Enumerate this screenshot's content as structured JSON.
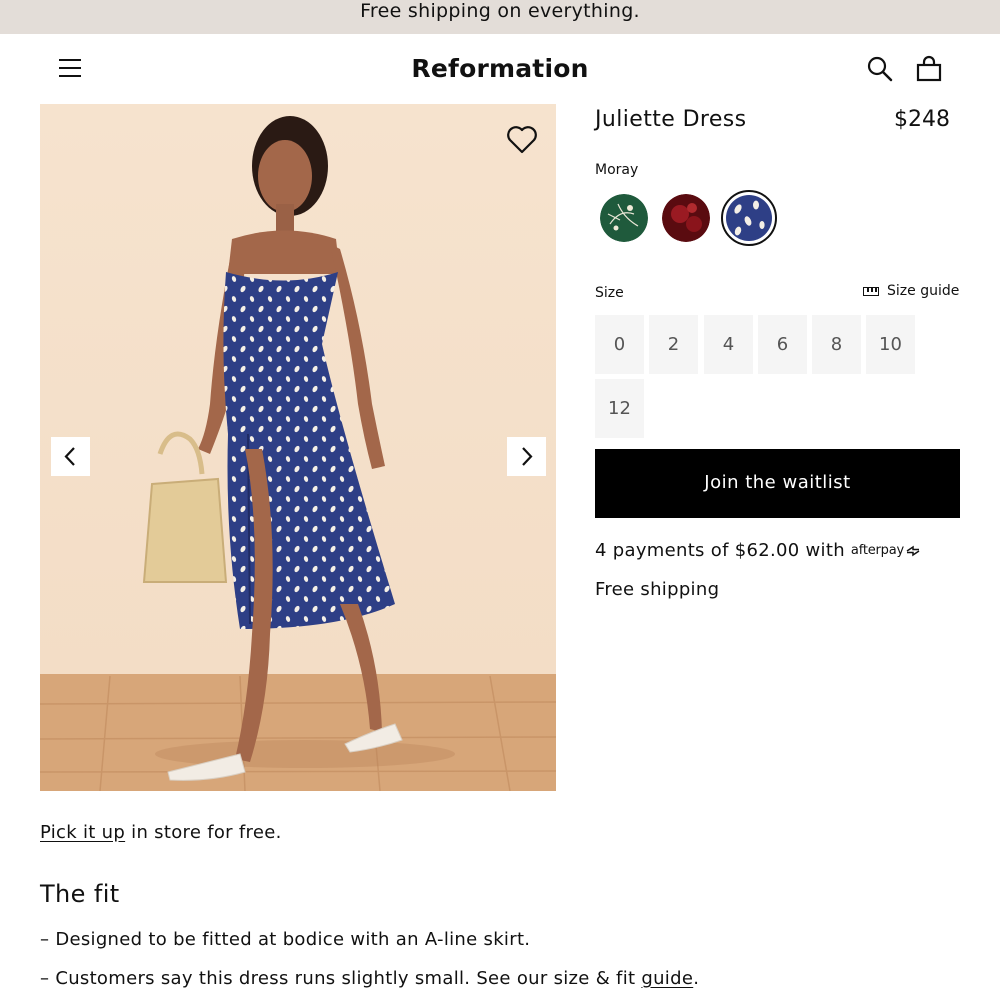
{
  "promo": {
    "text": "Free shipping on everything."
  },
  "header": {
    "logo": "Reformation",
    "icons": {
      "menu": "menu-icon",
      "search": "search-icon",
      "bag": "bag-icon"
    }
  },
  "gallery": {
    "icons": {
      "favorite": "heart-icon",
      "prev": "chevron-left-icon",
      "next": "chevron-right-icon"
    }
  },
  "product": {
    "name": "Juliette Dress",
    "price": "$248",
    "color_name": "Moray",
    "swatches": [
      {
        "name": "green floral",
        "color": "#1f5a3c"
      },
      {
        "name": "red floral",
        "color": "#6e0e14"
      },
      {
        "name": "Moray",
        "color": "#2e3f86",
        "selected": true
      }
    ],
    "size_label": "Size",
    "size_guide": "Size guide",
    "sizes": [
      "0",
      "2",
      "4",
      "6",
      "8",
      "10",
      "12"
    ],
    "cta": "Join the waitlist",
    "installments": "4 payments of $62.00 with",
    "afterpay": "afterpay",
    "shipping": "Free shipping"
  },
  "details": {
    "pickup_link": "Pick it up",
    "pickup_rest": " in store for free.",
    "fit_title": "The fit",
    "fit_item_1": "– Designed to be fitted at bodice with an A-line skirt.",
    "fit_item_2_pre": "– Customers say this dress runs slightly small. See our size & fit ",
    "fit_item_2_link": "guide",
    "fit_item_2_post": "."
  },
  "colors": {
    "promo_bg": "#e3ddd8",
    "cta_bg": "#000000",
    "size_bg": "#f5f5f5"
  }
}
